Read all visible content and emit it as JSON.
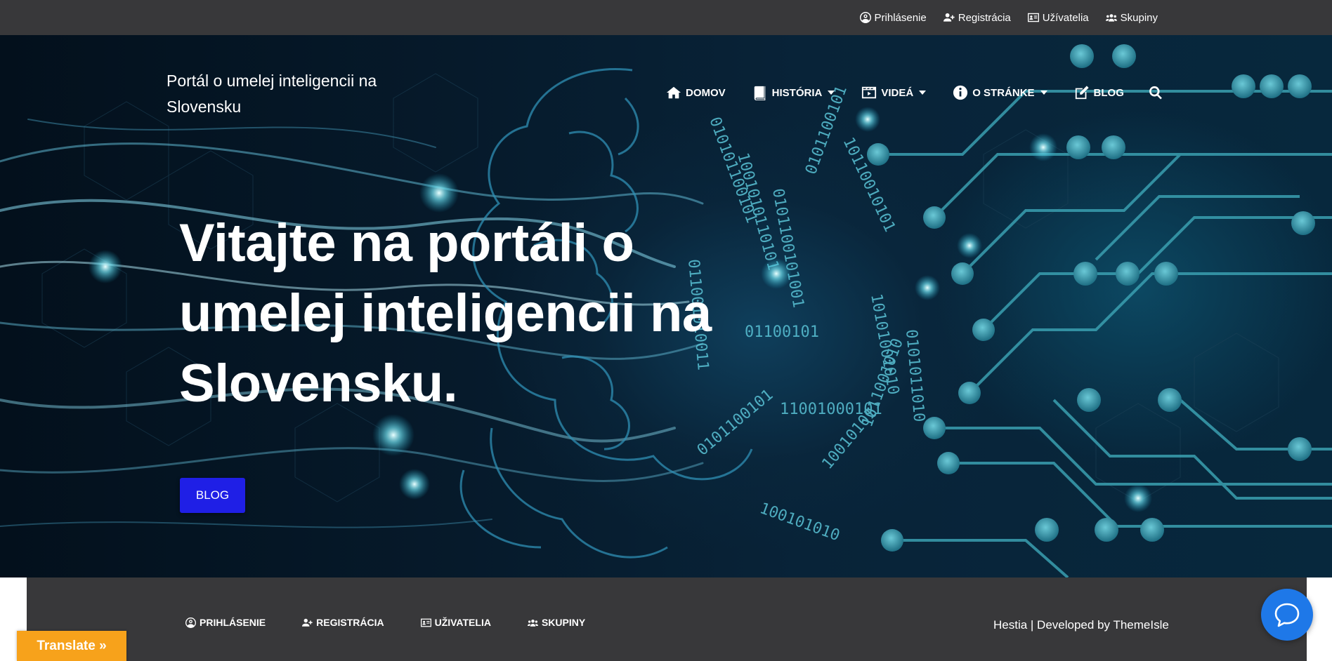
{
  "topbar": {
    "items": [
      {
        "label": "Prihlásenie",
        "icon": "user-circle-icon"
      },
      {
        "label": "Registrácia",
        "icon": "user-plus-icon"
      },
      {
        "label": "Užívatelia",
        "icon": "id-card-icon"
      },
      {
        "label": "Skupiny",
        "icon": "users-icon"
      }
    ]
  },
  "brand": {
    "title": "Portál o umelej inteligencii na Slovensku"
  },
  "nav": {
    "items": [
      {
        "label": "DOMOV",
        "icon": "home-icon",
        "dropdown": false
      },
      {
        "label": "HISTÓRIA",
        "icon": "book-icon",
        "dropdown": true
      },
      {
        "label": "VIDEÁ",
        "icon": "film-icon",
        "dropdown": true
      },
      {
        "label": "O STRÁNKE",
        "icon": "info-icon",
        "dropdown": true
      },
      {
        "label": "BLOG",
        "icon": "edit-icon",
        "dropdown": false
      }
    ],
    "search_icon": "search-icon"
  },
  "hero": {
    "headline": "Vitajte na portáli o umelej inteligencii na Slovensku.",
    "button_label": "BLOG"
  },
  "footer": {
    "items": [
      {
        "label": "PRIHLÁSENIE",
        "icon": "user-circle-icon"
      },
      {
        "label": "REGISTRÁCIA",
        "icon": "user-plus-icon"
      },
      {
        "label": "UŽIVATELIA",
        "icon": "id-card-icon"
      },
      {
        "label": "SKUPINY",
        "icon": "users-icon"
      }
    ],
    "credit_prefix": "Hestia | Developed by ",
    "credit_link": "ThemeIsle"
  },
  "widgets": {
    "translate_label": "Translate »",
    "chat_icon": "chat-bubble-icon"
  },
  "colors": {
    "topbar_bg": "#38383a",
    "accent_button": "#1f1fe6",
    "translate_bg": "#f7a21b",
    "chat_bg": "#1e78e8"
  }
}
